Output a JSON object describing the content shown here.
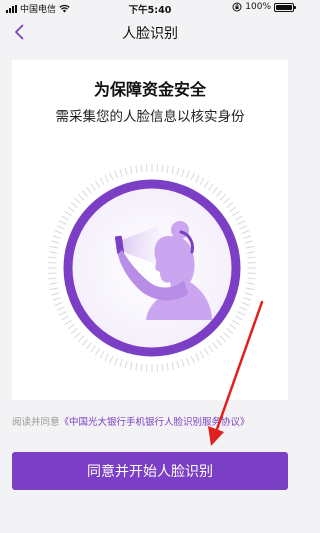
{
  "status_bar": {
    "carrier": "中国电信",
    "time": "下午5:40",
    "battery": "100%"
  },
  "nav": {
    "title": "人脸识别",
    "back_icon": "chevron-left-icon"
  },
  "card": {
    "headline": "为保障资金安全",
    "subline": "需采集您的人脸信息以核实身份",
    "illustration_icon": "face-scan-illustration-icon"
  },
  "agreement": {
    "prefix": "阅读并同意",
    "link_text": "《中国光大银行手机银行人脸识别服务协议》"
  },
  "primary_button": {
    "label": "同意并开始人脸识别"
  },
  "colors": {
    "brand": "#7a3fc4",
    "annotation_arrow": "#e0201e"
  }
}
